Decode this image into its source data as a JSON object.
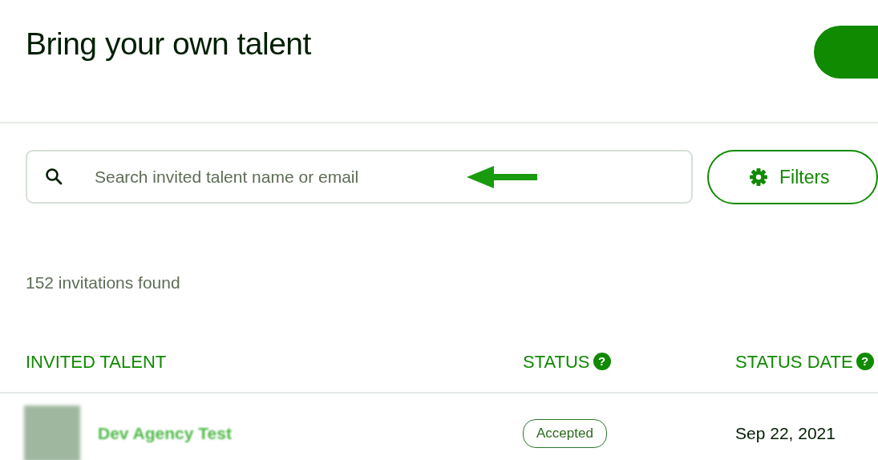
{
  "page": {
    "title": "Bring your own talent"
  },
  "search": {
    "placeholder": "Search invited talent name or email"
  },
  "filters_button": {
    "label": "Filters"
  },
  "result_count": "152 invitations found",
  "table": {
    "columns": [
      {
        "label": "INVITED TALENT"
      },
      {
        "label": "STATUS",
        "help_icon": "?"
      },
      {
        "label": "STATUS DATE",
        "help_icon": "?"
      }
    ],
    "rows": [
      {
        "name": "Dev Agency Test",
        "status": "Accepted",
        "status_date": "Sep 22, 2021"
      }
    ]
  }
}
